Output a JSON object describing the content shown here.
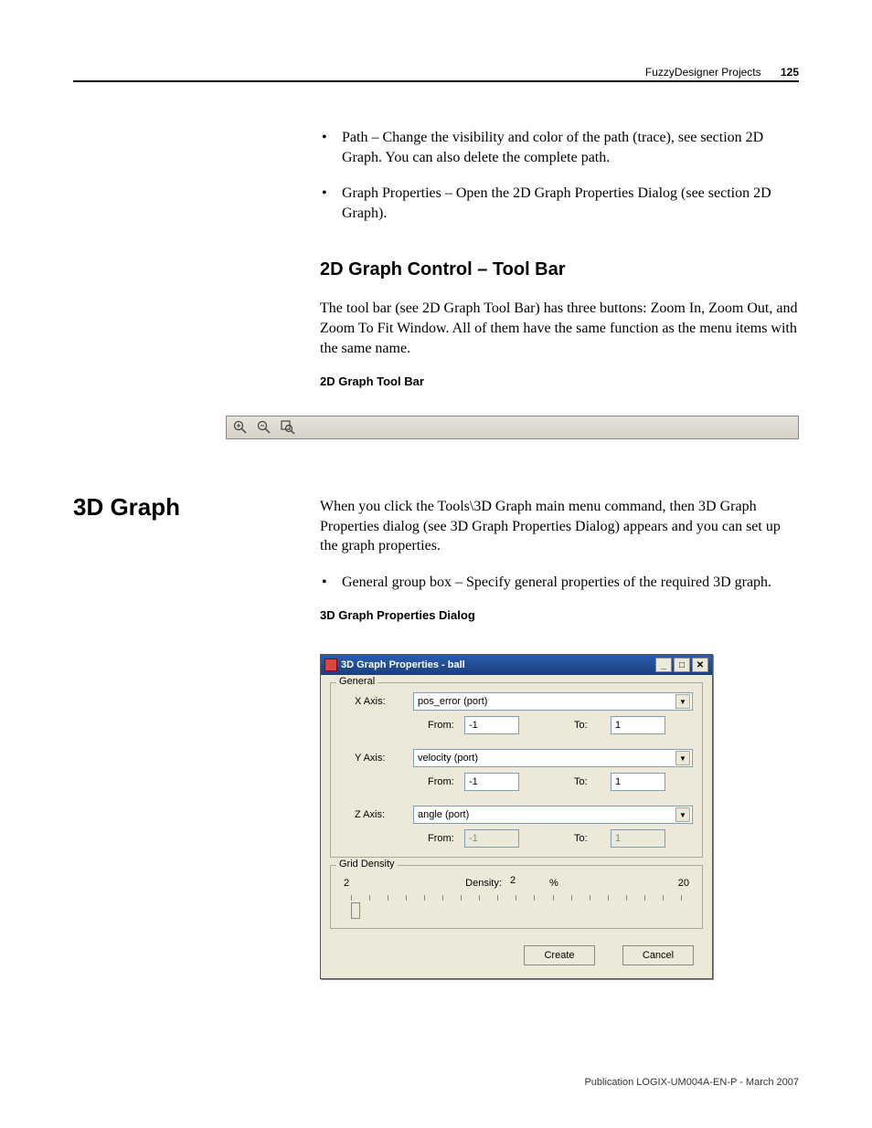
{
  "header": {
    "chapter": "FuzzyDesigner Projects",
    "page": "125"
  },
  "bullets_top": [
    "Path – Change the visibility and color of the path (trace), see section 2D Graph. You can also delete the complete path.",
    "Graph Properties – Open the 2D Graph Properties Dialog (see section 2D Graph)."
  ],
  "h_2d_toolbar": "2D Graph Control – Tool Bar",
  "p_2d_toolbar": "The tool bar (see 2D Graph Tool Bar) has three buttons: Zoom In, Zoom Out, and Zoom To Fit Window. All of them have the same function as the menu items with the same name.",
  "cap_2d_toolbar": "2D Graph Tool Bar",
  "side_3d": "3D Graph",
  "p_3d_intro": "When you click the Tools\\3D Graph main menu command, then 3D Graph Properties dialog (see 3D Graph Properties Dialog) appears and you can set up the graph properties.",
  "bullets_3d": [
    "General group box – Specify general properties of the required 3D graph."
  ],
  "cap_3d_dialog": "3D Graph Properties Dialog",
  "dialog": {
    "title": "3D Graph Properties - ball",
    "group_general": "General",
    "xaxis_label": "X Axis:",
    "xaxis_value": "pos_error (port)",
    "yaxis_label": "Y Axis:",
    "yaxis_value": "velocity (port)",
    "zaxis_label": "Z Axis:",
    "zaxis_value": "angle (port)",
    "from_label": "From:",
    "to_label": "To:",
    "x_from": "-1",
    "x_to": "1",
    "y_from": "-1",
    "y_to": "1",
    "z_from": "-1",
    "z_to": "1",
    "group_grid": "Grid Density",
    "grid_min": "2",
    "density_label": "Density:",
    "density_value": "2",
    "density_unit": "%",
    "grid_max": "20",
    "btn_create": "Create",
    "btn_cancel": "Cancel"
  },
  "footer": "Publication LOGIX-UM004A-EN-P - March 2007"
}
